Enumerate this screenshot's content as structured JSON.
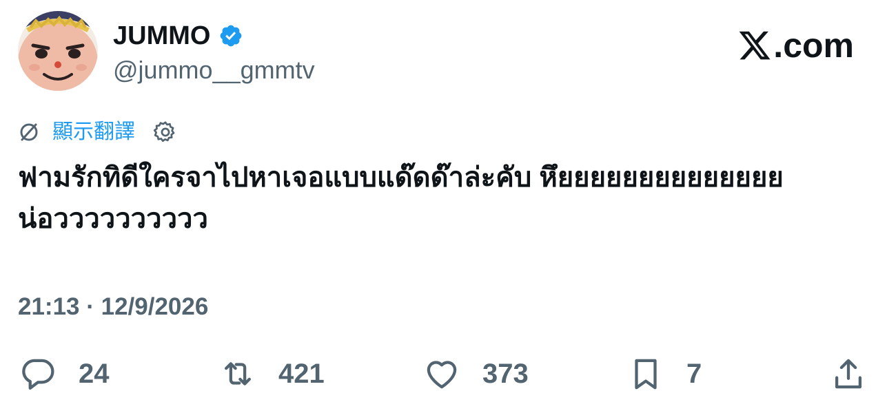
{
  "author": {
    "display_name": "JUMMO",
    "handle": "@jummo__gmmtv",
    "verified": true,
    "avatar_icon": "mascot-avatar"
  },
  "brand": {
    "name_rest": ".com",
    "logo_icon": "x-logo-icon"
  },
  "translate": {
    "label": "顯示翻譯",
    "icon": "translate-icon",
    "settings_icon": "gear-icon"
  },
  "tweet": {
    "text": "ฟามรักทิดีใครจาไปหาเจอแบบแด๊ดด๊าล่ะคับ หึยยยยยยยยยยยยยย น่อวววววววววว",
    "timestamp": "21:13 · 12/9/2026"
  },
  "actions": {
    "replies": "24",
    "reposts": "421",
    "likes": "373",
    "bookmarks": "7"
  },
  "colors": {
    "accent": "#1d9bf0",
    "text": "#0f1419",
    "secondary": "#536471"
  }
}
